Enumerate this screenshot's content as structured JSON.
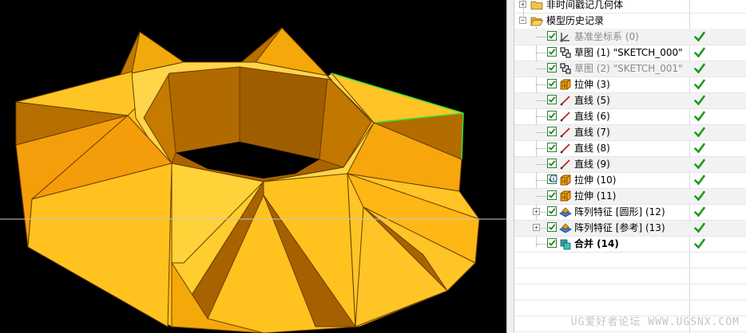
{
  "tree": {
    "groups": [
      {
        "label": "非时间戳记几何体"
      },
      {
        "label": "模型历史记录"
      }
    ],
    "items": [
      {
        "label": "基准坐标系 (0)",
        "icon": "datum-csys-icon",
        "state": "grey"
      },
      {
        "label": "草图 (1) \"SKETCH_000\"",
        "icon": "sketch-icon",
        "state": "normal"
      },
      {
        "label": "草图 (2) \"SKETCH_001\"",
        "icon": "sketch-icon",
        "state": "grey"
      },
      {
        "label": "拉伸 (3)",
        "icon": "extrude-icon",
        "state": "normal"
      },
      {
        "label": "直线 (5)",
        "icon": "line-icon",
        "state": "normal"
      },
      {
        "label": "直线 (6)",
        "icon": "line-icon",
        "state": "normal"
      },
      {
        "label": "直线 (7)",
        "icon": "line-icon",
        "state": "normal"
      },
      {
        "label": "直线 (8)",
        "icon": "line-icon",
        "state": "normal"
      },
      {
        "label": "直线 (9)",
        "icon": "line-icon",
        "state": "normal"
      },
      {
        "label": "拉伸 (10)",
        "icon": "extrude-icon",
        "state": "normal"
      },
      {
        "label": "拉伸 (11)",
        "icon": "extrude-icon",
        "state": "normal"
      },
      {
        "label": "阵列特征 [圆形] (12)",
        "icon": "pattern-icon",
        "state": "normal"
      },
      {
        "label": "阵列特征 [参考] (13)",
        "icon": "pattern-icon",
        "state": "normal"
      },
      {
        "label": "合并 (14)",
        "icon": "unite-icon",
        "state": "bold"
      }
    ]
  },
  "watermark": "UG爱好者论坛 WWW.UGSNX.COM",
  "colors": {
    "viewport_bg": "#000000",
    "model_light": "#FFC928",
    "model_mid": "#F5A80A",
    "model_dark": "#A96500",
    "selection_edge": "#3CE03C",
    "status_check": "#1A9A1A"
  }
}
